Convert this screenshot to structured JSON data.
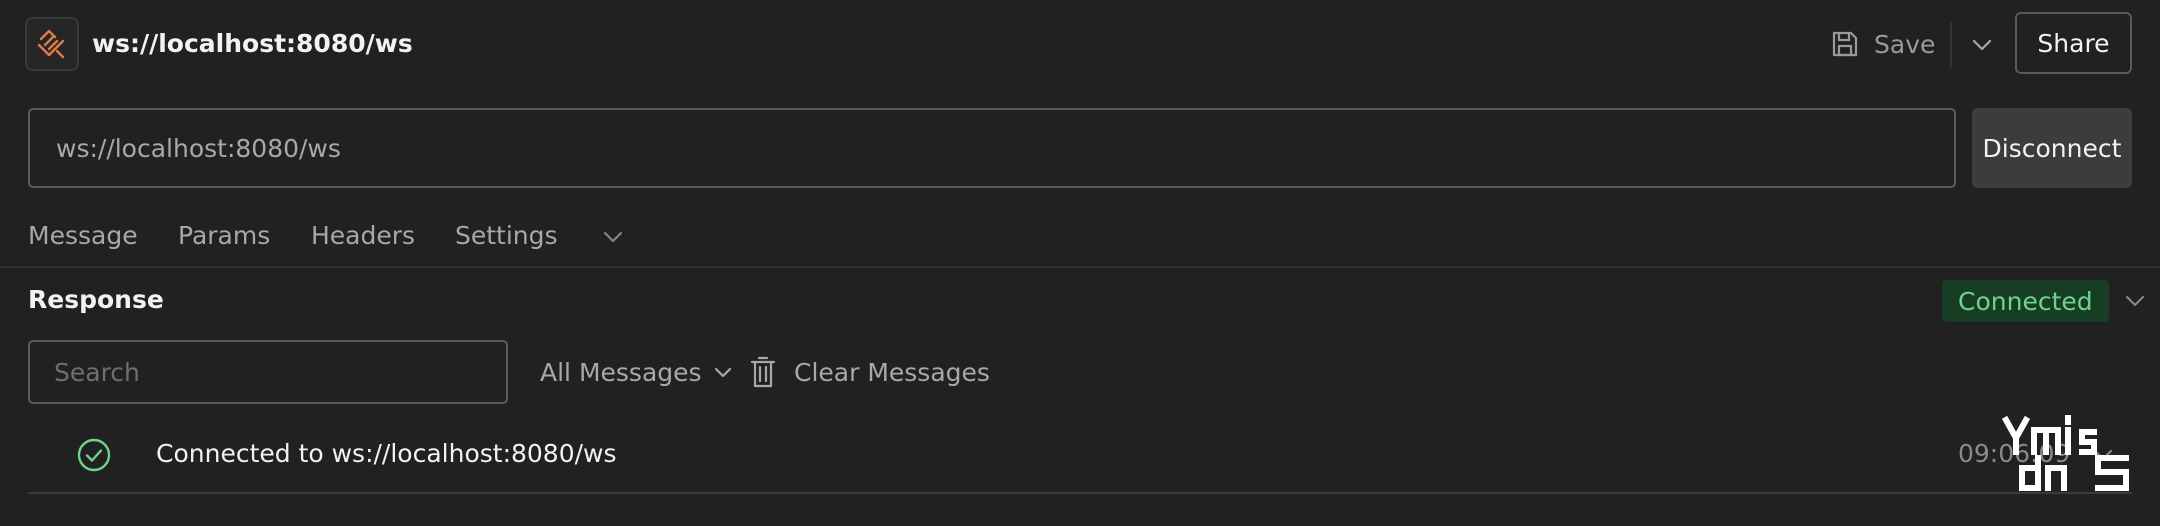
{
  "header": {
    "title": "ws://localhost:8080/ws",
    "save_label": "Save",
    "share_label": "Share",
    "app_icon": "websocket-icon"
  },
  "request": {
    "url_value": "ws://localhost:8080/ws",
    "disconnect_label": "Disconnect"
  },
  "tabs": [
    {
      "label": "Message"
    },
    {
      "label": "Params"
    },
    {
      "label": "Headers"
    },
    {
      "label": "Settings"
    }
  ],
  "response": {
    "title": "Response",
    "status": "Connected",
    "search_placeholder": "Search",
    "filter_value": "All Messages",
    "clear_label": "Clear Messages",
    "messages": [
      {
        "text": "Connected to ws://localhost:8080/ws",
        "time": "09:06:09",
        "icon": "check-circle-icon"
      }
    ]
  },
  "watermark": {
    "text": "ymis dnS"
  },
  "colors": {
    "background": "#212121",
    "accent": "#e07a4a",
    "status_text": "#6fd38c",
    "status_bg": "#173d24"
  }
}
